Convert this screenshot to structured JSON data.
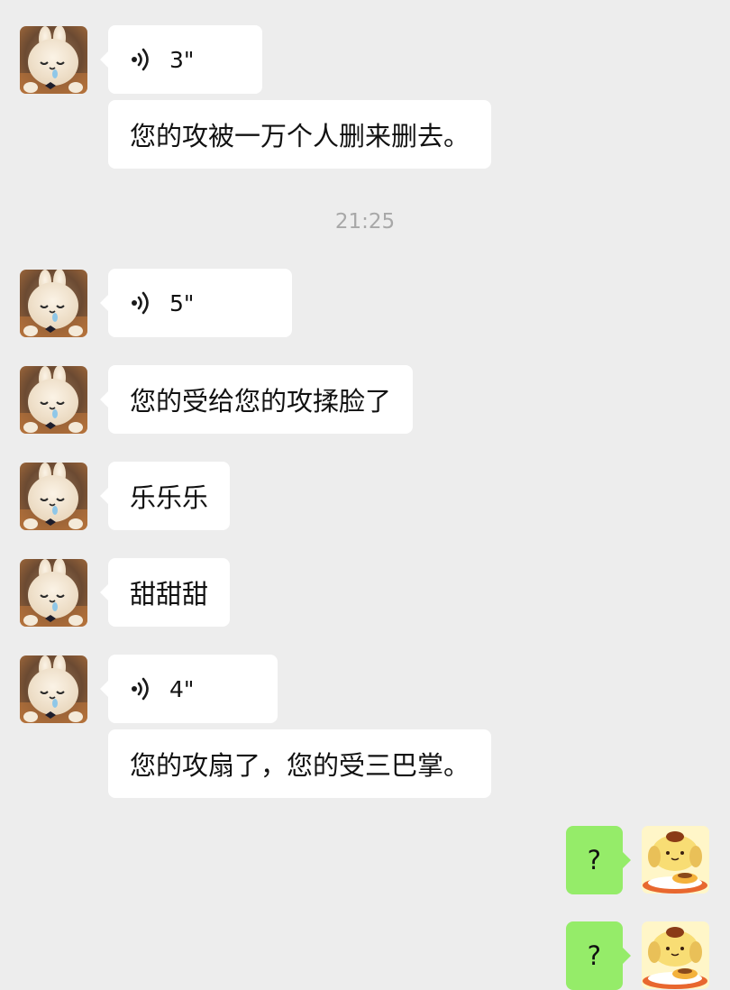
{
  "chat": {
    "timestamp": "21:25",
    "messages": [
      {
        "type": "voice",
        "duration": "3\""
      },
      {
        "type": "text",
        "text": "您的攻被一万个人删来删去。"
      },
      {
        "type": "voice",
        "duration": "5\""
      },
      {
        "type": "text",
        "text": "您的受给您的攻揉脸了"
      },
      {
        "type": "text",
        "text": "乐乐乐"
      },
      {
        "type": "text",
        "text": "甜甜甜"
      },
      {
        "type": "voice",
        "duration": "4\""
      },
      {
        "type": "text",
        "text": "您的攻扇了，您的受三巴掌。"
      },
      {
        "type": "text",
        "text": "?"
      },
      {
        "type": "text",
        "text": "?"
      }
    ]
  },
  "avatars": {
    "other": "bunny-plush-avatar",
    "self": "pudding-dog-avatar"
  },
  "colors": {
    "background": "#ededed",
    "incoming_bubble": "#ffffff",
    "outgoing_bubble": "#95ec69",
    "timestamp": "#a8a8a8"
  }
}
